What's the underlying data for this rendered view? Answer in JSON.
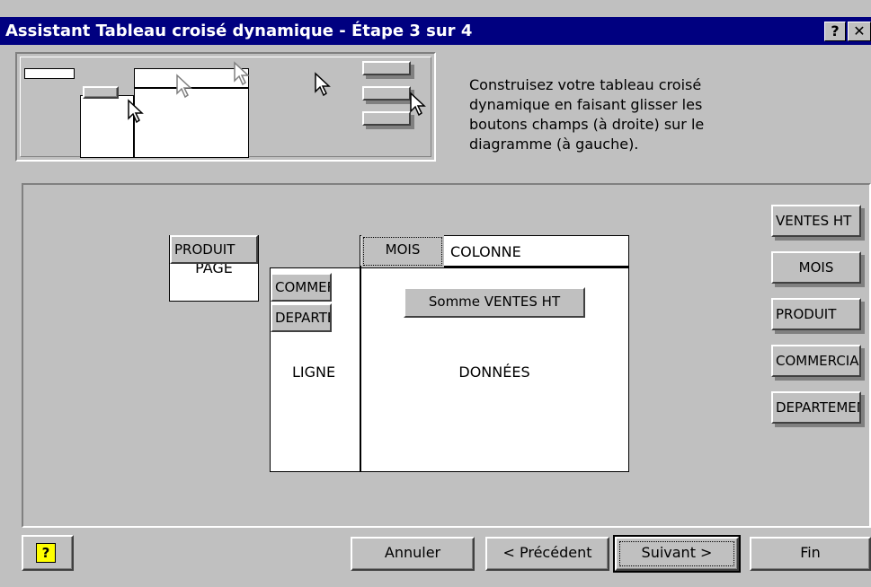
{
  "title": "Assistant Tableau croisé dynamique - Étape 3 sur 4",
  "title_buttons": {
    "help": "?",
    "close": "✕"
  },
  "description": [
    "Construisez votre tableau croisé",
    "dynamique en faisant glisser les",
    "boutons champs (à droite) sur le",
    "diagramme (à gauche)."
  ],
  "layout": {
    "page_field": "PRODUIT",
    "page_label": "PAGE",
    "column_field": "MOIS",
    "column_label": "COLONNE",
    "row_fields": [
      "COMMERCIAL",
      "DEPARTEMENT"
    ],
    "row_label": "LIGNE",
    "data_field": "Somme VENTES HT",
    "data_label": "DONNÉES"
  },
  "field_list": [
    "VENTES HT",
    "MOIS",
    "PRODUIT",
    "COMMERCIAL",
    "DEPARTEMENT"
  ],
  "buttons": {
    "help_icon": "?",
    "cancel": "Annuler",
    "previous": "< Précédent",
    "next": "Suivant >",
    "finish": "Fin"
  },
  "colors": {
    "titlebar": "#000080",
    "face": "#c0c0c0"
  }
}
